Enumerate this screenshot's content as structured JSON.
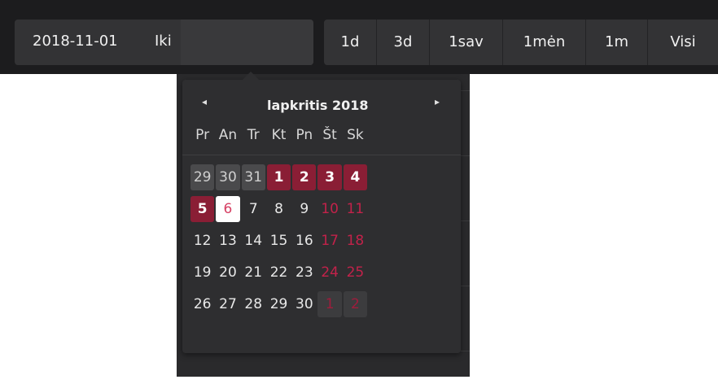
{
  "toolbar": {
    "date_from": "2018-11-01",
    "separator": "Iki",
    "date_to_value": "",
    "ranges": [
      "1d",
      "3d",
      "1sav",
      "1mėn",
      "1m",
      "Visi"
    ]
  },
  "calendar": {
    "month_title": "lapkritis 2018",
    "prev_icon": "◂",
    "next_icon": "▸",
    "weekdays": [
      "Pr",
      "An",
      "Tr",
      "Kt",
      "Pn",
      "Št",
      "Sk"
    ],
    "weeks": [
      [
        {
          "d": "29",
          "k": "other"
        },
        {
          "d": "30",
          "k": "other"
        },
        {
          "d": "31",
          "k": "other"
        },
        {
          "d": "1",
          "k": "sel"
        },
        {
          "d": "2",
          "k": "sel"
        },
        {
          "d": "3",
          "k": "sel"
        },
        {
          "d": "4",
          "k": "sel"
        }
      ],
      [
        {
          "d": "5",
          "k": "sel"
        },
        {
          "d": "6",
          "k": "today"
        },
        {
          "d": "7",
          "k": ""
        },
        {
          "d": "8",
          "k": ""
        },
        {
          "d": "9",
          "k": ""
        },
        {
          "d": "10",
          "k": "weekend"
        },
        {
          "d": "11",
          "k": "weekend"
        }
      ],
      [
        {
          "d": "12",
          "k": ""
        },
        {
          "d": "13",
          "k": ""
        },
        {
          "d": "14",
          "k": ""
        },
        {
          "d": "15",
          "k": ""
        },
        {
          "d": "16",
          "k": ""
        },
        {
          "d": "17",
          "k": "weekend"
        },
        {
          "d": "18",
          "k": "weekend"
        }
      ],
      [
        {
          "d": "19",
          "k": ""
        },
        {
          "d": "20",
          "k": ""
        },
        {
          "d": "21",
          "k": ""
        },
        {
          "d": "22",
          "k": ""
        },
        {
          "d": "23",
          "k": ""
        },
        {
          "d": "24",
          "k": "weekend"
        },
        {
          "d": "25",
          "k": "weekend"
        }
      ],
      [
        {
          "d": "26",
          "k": ""
        },
        {
          "d": "27",
          "k": ""
        },
        {
          "d": "28",
          "k": ""
        },
        {
          "d": "29",
          "k": ""
        },
        {
          "d": "30",
          "k": ""
        },
        {
          "d": "1",
          "k": "weekend other"
        },
        {
          "d": "2",
          "k": "weekend other"
        }
      ]
    ]
  },
  "colors": {
    "toolbar_bg": "#1c1c1e",
    "selected": "#8a1e35",
    "weekend_text": "#c2224a",
    "today_bg": "#ffffff"
  }
}
